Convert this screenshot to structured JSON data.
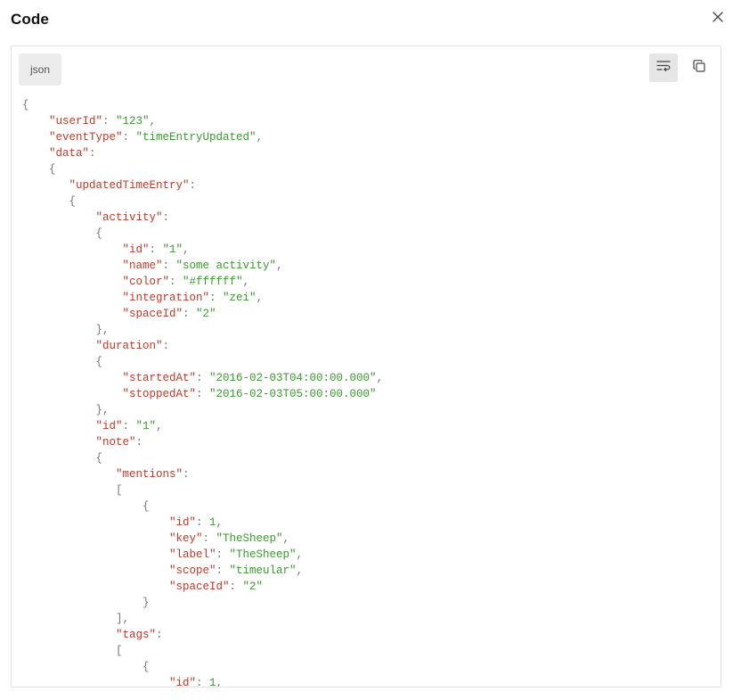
{
  "dialog": {
    "title": "Code",
    "close_icon": "close-icon"
  },
  "toolbar": {
    "language": "json",
    "wrap_icon": "wrap-lines-icon",
    "copy_icon": "copy-icon"
  },
  "colors": {
    "key": "#c0392b",
    "string": "#3a9a2e",
    "punctuation": "#777777",
    "wrap_active_bg": "#e6e6e6"
  },
  "code_lines": [
    {
      "indent": 0,
      "parts": [
        {
          "t": "p",
          "v": "{"
        }
      ]
    },
    {
      "indent": 4,
      "parts": [
        {
          "t": "k",
          "v": "\"userId\""
        },
        {
          "t": "p",
          "v": ": "
        },
        {
          "t": "s",
          "v": "\"123\""
        },
        {
          "t": "p",
          "v": ","
        }
      ]
    },
    {
      "indent": 4,
      "parts": [
        {
          "t": "k",
          "v": "\"eventType\""
        },
        {
          "t": "p",
          "v": ": "
        },
        {
          "t": "s",
          "v": "\"timeEntryUpdated\""
        },
        {
          "t": "p",
          "v": ","
        }
      ]
    },
    {
      "indent": 4,
      "parts": [
        {
          "t": "k",
          "v": "\"data\""
        },
        {
          "t": "p",
          "v": ":"
        }
      ]
    },
    {
      "indent": 4,
      "parts": [
        {
          "t": "p",
          "v": "{"
        }
      ]
    },
    {
      "indent": 7,
      "parts": [
        {
          "t": "k",
          "v": "\"updatedTimeEntry\""
        },
        {
          "t": "p",
          "v": ":"
        }
      ]
    },
    {
      "indent": 7,
      "parts": [
        {
          "t": "p",
          "v": "{"
        }
      ]
    },
    {
      "indent": 11,
      "parts": [
        {
          "t": "k",
          "v": "\"activity\""
        },
        {
          "t": "p",
          "v": ":"
        }
      ]
    },
    {
      "indent": 11,
      "parts": [
        {
          "t": "p",
          "v": "{"
        }
      ]
    },
    {
      "indent": 15,
      "parts": [
        {
          "t": "k",
          "v": "\"id\""
        },
        {
          "t": "p",
          "v": ": "
        },
        {
          "t": "s",
          "v": "\"1\""
        },
        {
          "t": "p",
          "v": ","
        }
      ]
    },
    {
      "indent": 15,
      "parts": [
        {
          "t": "k",
          "v": "\"name\""
        },
        {
          "t": "p",
          "v": ": "
        },
        {
          "t": "s",
          "v": "\"some activity\""
        },
        {
          "t": "p",
          "v": ","
        }
      ]
    },
    {
      "indent": 15,
      "parts": [
        {
          "t": "k",
          "v": "\"color\""
        },
        {
          "t": "p",
          "v": ": "
        },
        {
          "t": "s",
          "v": "\"#ffffff\""
        },
        {
          "t": "p",
          "v": ","
        }
      ]
    },
    {
      "indent": 15,
      "parts": [
        {
          "t": "k",
          "v": "\"integration\""
        },
        {
          "t": "p",
          "v": ": "
        },
        {
          "t": "s",
          "v": "\"zei\""
        },
        {
          "t": "p",
          "v": ","
        }
      ]
    },
    {
      "indent": 15,
      "parts": [
        {
          "t": "k",
          "v": "\"spaceId\""
        },
        {
          "t": "p",
          "v": ": "
        },
        {
          "t": "s",
          "v": "\"2\""
        }
      ]
    },
    {
      "indent": 11,
      "parts": [
        {
          "t": "p",
          "v": "},"
        }
      ]
    },
    {
      "indent": 11,
      "parts": [
        {
          "t": "k",
          "v": "\"duration\""
        },
        {
          "t": "p",
          "v": ":"
        }
      ]
    },
    {
      "indent": 11,
      "parts": [
        {
          "t": "p",
          "v": "{"
        }
      ]
    },
    {
      "indent": 15,
      "parts": [
        {
          "t": "k",
          "v": "\"startedAt\""
        },
        {
          "t": "p",
          "v": ": "
        },
        {
          "t": "s",
          "v": "\"2016-02-03T04:00:00.000\""
        },
        {
          "t": "p",
          "v": ","
        }
      ]
    },
    {
      "indent": 15,
      "parts": [
        {
          "t": "k",
          "v": "\"stoppedAt\""
        },
        {
          "t": "p",
          "v": ": "
        },
        {
          "t": "s",
          "v": "\"2016-02-03T05:00:00.000\""
        }
      ]
    },
    {
      "indent": 11,
      "parts": [
        {
          "t": "p",
          "v": "},"
        }
      ]
    },
    {
      "indent": 11,
      "parts": [
        {
          "t": "k",
          "v": "\"id\""
        },
        {
          "t": "p",
          "v": ": "
        },
        {
          "t": "s",
          "v": "\"1\""
        },
        {
          "t": "p",
          "v": ","
        }
      ]
    },
    {
      "indent": 11,
      "parts": [
        {
          "t": "k",
          "v": "\"note\""
        },
        {
          "t": "p",
          "v": ":"
        }
      ]
    },
    {
      "indent": 11,
      "parts": [
        {
          "t": "p",
          "v": "{"
        }
      ]
    },
    {
      "indent": 14,
      "parts": [
        {
          "t": "k",
          "v": "\"mentions\""
        },
        {
          "t": "p",
          "v": ":"
        }
      ]
    },
    {
      "indent": 14,
      "parts": [
        {
          "t": "p",
          "v": "["
        }
      ]
    },
    {
      "indent": 18,
      "parts": [
        {
          "t": "p",
          "v": "{"
        }
      ]
    },
    {
      "indent": 22,
      "parts": [
        {
          "t": "k",
          "v": "\"id\""
        },
        {
          "t": "p",
          "v": ": "
        },
        {
          "t": "n",
          "v": "1"
        },
        {
          "t": "p",
          "v": ","
        }
      ]
    },
    {
      "indent": 22,
      "parts": [
        {
          "t": "k",
          "v": "\"key\""
        },
        {
          "t": "p",
          "v": ": "
        },
        {
          "t": "s",
          "v": "\"TheSheep\""
        },
        {
          "t": "p",
          "v": ","
        }
      ]
    },
    {
      "indent": 22,
      "parts": [
        {
          "t": "k",
          "v": "\"label\""
        },
        {
          "t": "p",
          "v": ": "
        },
        {
          "t": "s",
          "v": "\"TheSheep\""
        },
        {
          "t": "p",
          "v": ","
        }
      ]
    },
    {
      "indent": 22,
      "parts": [
        {
          "t": "k",
          "v": "\"scope\""
        },
        {
          "t": "p",
          "v": ": "
        },
        {
          "t": "s",
          "v": "\"timeular\""
        },
        {
          "t": "p",
          "v": ","
        }
      ]
    },
    {
      "indent": 22,
      "parts": [
        {
          "t": "k",
          "v": "\"spaceId\""
        },
        {
          "t": "p",
          "v": ": "
        },
        {
          "t": "s",
          "v": "\"2\""
        }
      ]
    },
    {
      "indent": 18,
      "parts": [
        {
          "t": "p",
          "v": "}"
        }
      ]
    },
    {
      "indent": 14,
      "parts": [
        {
          "t": "p",
          "v": "],"
        }
      ]
    },
    {
      "indent": 14,
      "parts": [
        {
          "t": "k",
          "v": "\"tags\""
        },
        {
          "t": "p",
          "v": ":"
        }
      ]
    },
    {
      "indent": 14,
      "parts": [
        {
          "t": "p",
          "v": "["
        }
      ]
    },
    {
      "indent": 18,
      "parts": [
        {
          "t": "p",
          "v": "{"
        }
      ]
    },
    {
      "indent": 22,
      "parts": [
        {
          "t": "k",
          "v": "\"id\""
        },
        {
          "t": "p",
          "v": ": "
        },
        {
          "t": "n",
          "v": "1"
        },
        {
          "t": "p",
          "v": ","
        }
      ]
    }
  ]
}
